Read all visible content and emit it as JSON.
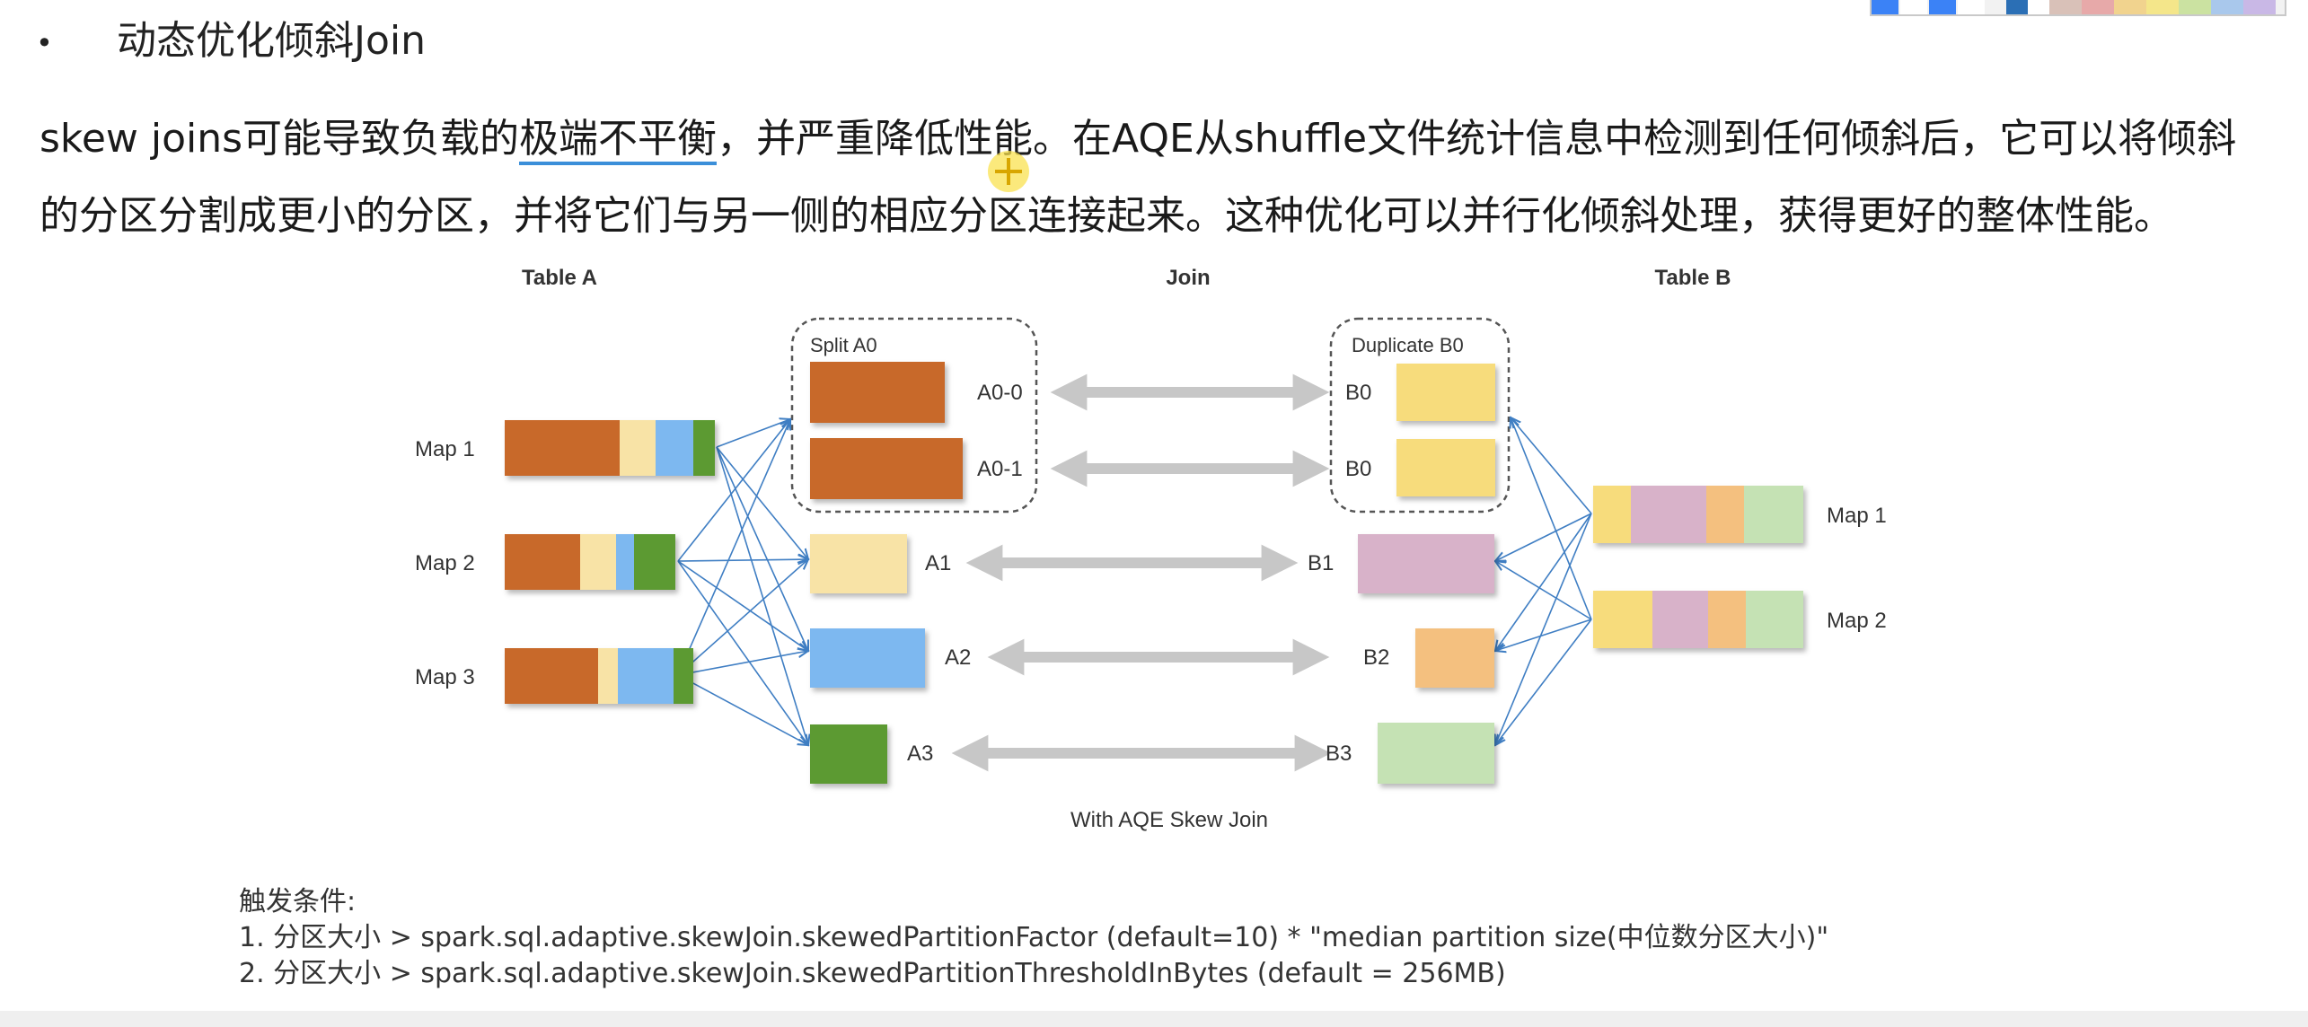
{
  "bullet": {
    "symbol": "•",
    "text": "动态优化倾斜Join"
  },
  "paragraph": {
    "part1": "skew joins可能导致负载的",
    "highlight": "极端不平衡",
    "part2": "，并严重降低性能。在AQE从shuffle文件统计信息中检测到任何倾斜后，它可以将倾斜的分区分割成更小的分区，并将它们与另一侧的相应分区连接起来。这种优化可以并行化倾斜处理，获得更好的整体性能。"
  },
  "diagram": {
    "header_table_a": "Table A",
    "header_join": "Join",
    "header_table_b": "Table B",
    "split_label": "Split A0",
    "duplicate_label": "Duplicate B0",
    "a_maps": [
      "Map 1",
      "Map 2",
      "Map 3"
    ],
    "b_maps": [
      "Map 1",
      "Map 2"
    ],
    "a_partitions": [
      "A0-0",
      "A0-1",
      "A1",
      "A2",
      "A3"
    ],
    "b_partitions": [
      "B0",
      "B0",
      "B1",
      "B2",
      "B3"
    ],
    "caption": "With AQE Skew Join",
    "colors": {
      "orange": "#c8692a",
      "cream": "#f8e3a6",
      "blue": "#7db8f0",
      "green": "#5c9a33",
      "yellow": "#f7dc7b",
      "mauve": "#d8b2c9",
      "peach": "#f4c07f",
      "mint": "#c5e2b4",
      "arrow_gray": "#c7c7c7",
      "line_blue": "#3f7ec3"
    }
  },
  "notes": {
    "title": "触发条件:",
    "line1": "1. 分区大小 > spark.sql.adaptive.skewJoin.skewedPartitionFactor (default=10) * \"median partition size(中位数分区大小)\"",
    "line2": "2. 分区大小 > spark.sql.adaptive.skewJoin.skewedPartitionThresholdInBytes (default = 256MB)"
  }
}
